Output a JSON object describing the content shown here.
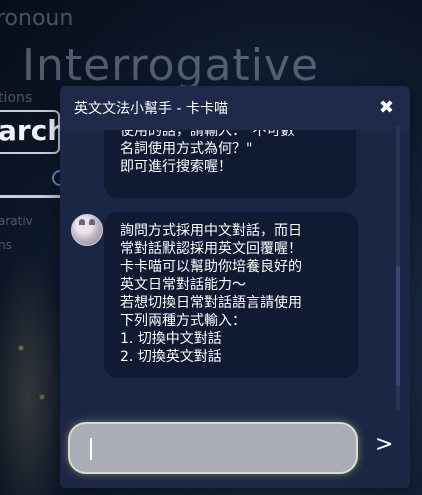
{
  "background": {
    "word_pronoun": "ronoun",
    "word_title": "Interrogative",
    "word_tions": "tions",
    "search_label": "arch",
    "side1": "arativ",
    "side2": "ns"
  },
  "chat": {
    "title": "英文文法小幫手 - 卡卡喵",
    "close_label": "✖",
    "prev_message": "使用的話，請輸入：\"不可數\n名詞使用方式為何？\"\n即可進行搜索喔！",
    "main_message": "詢問方式採用中文對話，而日\n常對話默認採用英文回覆喔！\n卡卡喵可以幫助你培養良好的\n英文日常對話能力～\n若想切換日常對話語言請使用\n下列兩種方式輸入：\n1. 切換中文對話\n2. 切換英文對話",
    "input_value": "",
    "input_placeholder": "",
    "send_label": ">"
  }
}
